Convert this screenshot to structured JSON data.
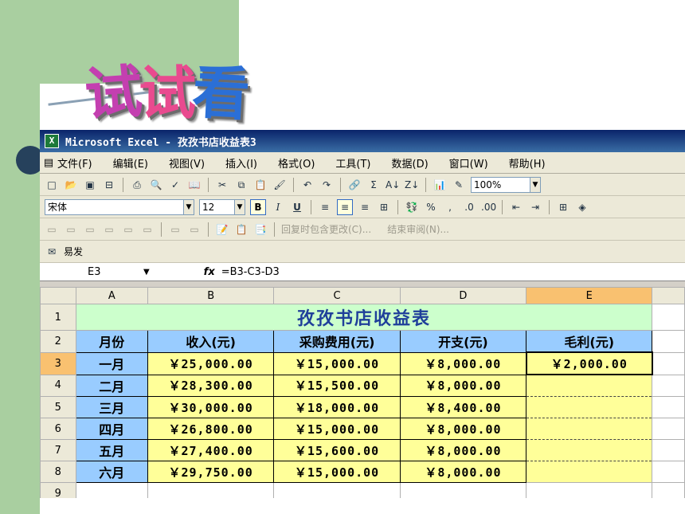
{
  "slide": {
    "title_chars": [
      "试",
      "试",
      "看"
    ]
  },
  "window": {
    "title": "Microsoft Excel - 孜孜书店收益表3",
    "logo": "X"
  },
  "menu": [
    "文件(F)",
    "编辑(E)",
    "视图(V)",
    "插入(I)",
    "格式(O)",
    "工具(T)",
    "数据(D)",
    "窗口(W)",
    "帮助(H)"
  ],
  "toolbar": {
    "zoom": "100%",
    "font_name": "宋体",
    "font_size": "12",
    "bold_label": "B",
    "italic_label": "I",
    "underline_label": "U",
    "percent": "%",
    "comma": ",",
    "reply_changes": "回复时包含更改(C)...",
    "end_review": "结束审阅(N)...",
    "send_label": "易发"
  },
  "formula_bar": {
    "cell_ref": "E3",
    "fx": "fx",
    "formula": "=B3-C3-D3"
  },
  "sheet": {
    "columns": [
      "A",
      "B",
      "C",
      "D",
      "E"
    ],
    "title": "孜孜书店收益表",
    "headers": [
      "月份",
      "收入(元)",
      "采购费用(元)",
      "开支(元)",
      "毛利(元)"
    ],
    "rows": [
      {
        "num": "3",
        "month": "一月",
        "income": "￥25,000.00",
        "purchase": "￥15,000.00",
        "expense": "￥8,000.00",
        "profit": "￥2,000.00"
      },
      {
        "num": "4",
        "month": "二月",
        "income": "￥28,300.00",
        "purchase": "￥15,500.00",
        "expense": "￥8,000.00",
        "profit": ""
      },
      {
        "num": "5",
        "month": "三月",
        "income": "￥30,000.00",
        "purchase": "￥18,000.00",
        "expense": "￥8,400.00",
        "profit": ""
      },
      {
        "num": "6",
        "month": "四月",
        "income": "￥26,800.00",
        "purchase": "￥15,000.00",
        "expense": "￥8,000.00",
        "profit": ""
      },
      {
        "num": "7",
        "month": "五月",
        "income": "￥27,400.00",
        "purchase": "￥15,600.00",
        "expense": "￥8,000.00",
        "profit": ""
      },
      {
        "num": "8",
        "month": "六月",
        "income": "￥29,750.00",
        "purchase": "￥15,000.00",
        "expense": "￥8,000.00",
        "profit": ""
      }
    ],
    "row_nums": [
      "1",
      "2",
      "9"
    ]
  }
}
